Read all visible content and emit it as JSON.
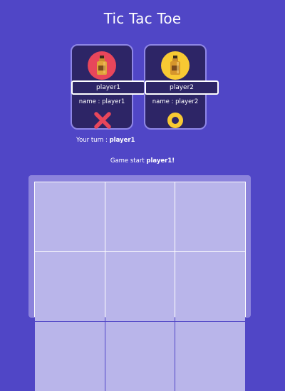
{
  "header": {
    "title": "Tic Tac Toe"
  },
  "players": [
    {
      "input_value": "player1",
      "name_label": "name : player1",
      "avatar_icon": "bottle-icon",
      "avatar_color": "#e8465b",
      "mark": "x-mark-icon",
      "mark_color": "#e8465b"
    },
    {
      "input_value": "player2",
      "name_label": "name : player2",
      "avatar_icon": "bottle-icon",
      "avatar_color": "#f8c933",
      "mark": "o-mark-icon",
      "mark_color": "#f8c933"
    }
  ],
  "turn": {
    "label": "Your turn : ",
    "player": "player1"
  },
  "status": {
    "label": "Game start ",
    "player": "player1!"
  },
  "board": {
    "cells": [
      "",
      "",
      "",
      "",
      "",
      "",
      "",
      "",
      ""
    ]
  },
  "colors": {
    "background": "#5046c6",
    "card": "#2d2566",
    "cell": "#b9b5ea"
  }
}
